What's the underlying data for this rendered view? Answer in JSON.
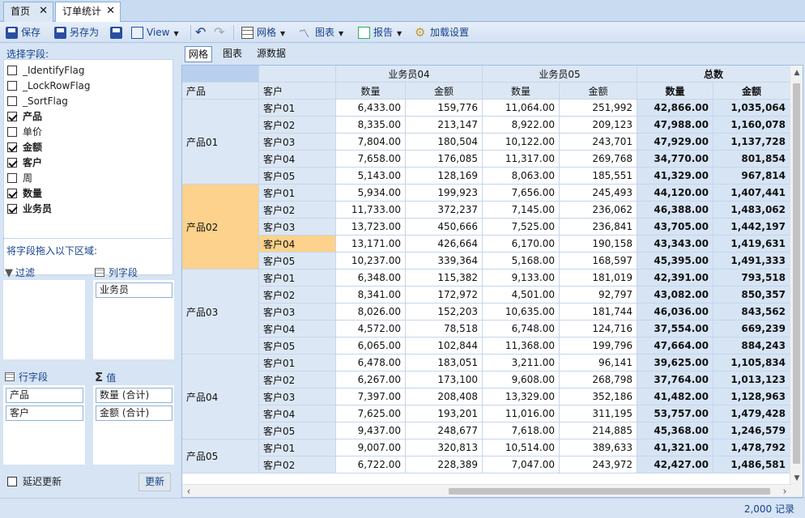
{
  "tabs": [
    {
      "label": "首页"
    },
    {
      "label": "订单统计"
    }
  ],
  "toolbar": {
    "save": "保存",
    "save_as": "另存为",
    "view": "View",
    "grid": "网格",
    "chart": "图表",
    "report": "报告",
    "load_settings": "加载设置"
  },
  "left": {
    "select_fields": "选择字段:",
    "fields": [
      {
        "label": "_IdentifyFlag",
        "checked": false
      },
      {
        "label": "_LockRowFlag",
        "checked": false
      },
      {
        "label": "_SortFlag",
        "checked": false
      },
      {
        "label": "产品",
        "checked": true
      },
      {
        "label": "单价",
        "checked": false
      },
      {
        "label": "金额",
        "checked": true
      },
      {
        "label": "客户",
        "checked": true
      },
      {
        "label": "周",
        "checked": false
      },
      {
        "label": "数量",
        "checked": true
      },
      {
        "label": "业务员",
        "checked": true
      }
    ],
    "drag_hint": "将字段拖入以下区域:",
    "filter_label": "过滤",
    "column_label": "列字段",
    "column_fields": [
      "业务员"
    ],
    "row_label": "行字段",
    "row_fields": [
      "产品",
      "客户"
    ],
    "value_label": "值",
    "value_fields": [
      "数量 (合计)",
      "金额 (合计)"
    ],
    "defer_update": "延迟更新",
    "refresh": "更新"
  },
  "view_tabs": [
    "网格",
    "图表",
    "源数据"
  ],
  "grid": {
    "header_groups": [
      "业务员04",
      "业务员05",
      "总数"
    ],
    "row_header_product": "产品",
    "row_header_customer": "客户",
    "qty": "数量",
    "amount": "金额",
    "rows": [
      {
        "product": "产品01",
        "customer": "客户01",
        "q4": "6,433.00",
        "a4": "159,776",
        "q5": "11,064.00",
        "a5": "251,992",
        "tq": "42,866.00",
        "ta": "1,035,064"
      },
      {
        "product": "",
        "customer": "客户02",
        "q4": "8,335.00",
        "a4": "213,147",
        "q5": "8,922.00",
        "a5": "209,123",
        "tq": "47,988.00",
        "ta": "1,160,078"
      },
      {
        "product": "",
        "customer": "客户03",
        "q4": "7,804.00",
        "a4": "180,504",
        "q5": "10,122.00",
        "a5": "243,701",
        "tq": "47,929.00",
        "ta": "1,137,728"
      },
      {
        "product": "",
        "customer": "客户04",
        "q4": "7,658.00",
        "a4": "176,085",
        "q5": "11,317.00",
        "a5": "269,768",
        "tq": "34,770.00",
        "ta": "801,854"
      },
      {
        "product": "",
        "customer": "客户05",
        "q4": "5,143.00",
        "a4": "128,169",
        "q5": "8,063.00",
        "a5": "185,551",
        "tq": "41,329.00",
        "ta": "967,814"
      },
      {
        "product": "产品02",
        "customer": "客户01",
        "q4": "5,934.00",
        "a4": "199,923",
        "q5": "7,656.00",
        "a5": "245,493",
        "tq": "44,120.00",
        "ta": "1,407,441"
      },
      {
        "product": "",
        "customer": "客户02",
        "q4": "11,733.00",
        "a4": "372,237",
        "q5": "7,145.00",
        "a5": "236,062",
        "tq": "46,388.00",
        "ta": "1,483,062"
      },
      {
        "product": "",
        "customer": "客户03",
        "q4": "13,723.00",
        "a4": "450,666",
        "q5": "7,525.00",
        "a5": "236,841",
        "tq": "43,705.00",
        "ta": "1,442,197"
      },
      {
        "product": "",
        "customer": "客户04",
        "q4": "13,171.00",
        "a4": "426,664",
        "q5": "6,170.00",
        "a5": "190,158",
        "tq": "43,343.00",
        "ta": "1,419,631"
      },
      {
        "product": "",
        "customer": "客户05",
        "q4": "10,237.00",
        "a4": "339,364",
        "q5": "5,168.00",
        "a5": "168,597",
        "tq": "45,395.00",
        "ta": "1,491,333"
      },
      {
        "product": "产品03",
        "customer": "客户01",
        "q4": "6,348.00",
        "a4": "115,382",
        "q5": "9,133.00",
        "a5": "181,019",
        "tq": "42,391.00",
        "ta": "793,518"
      },
      {
        "product": "",
        "customer": "客户02",
        "q4": "8,341.00",
        "a4": "172,972",
        "q5": "4,501.00",
        "a5": "92,797",
        "tq": "43,082.00",
        "ta": "850,357"
      },
      {
        "product": "",
        "customer": "客户03",
        "q4": "8,026.00",
        "a4": "152,203",
        "q5": "10,635.00",
        "a5": "181,744",
        "tq": "46,036.00",
        "ta": "843,562"
      },
      {
        "product": "",
        "customer": "客户04",
        "q4": "4,572.00",
        "a4": "78,518",
        "q5": "6,748.00",
        "a5": "124,716",
        "tq": "37,554.00",
        "ta": "669,239"
      },
      {
        "product": "",
        "customer": "客户05",
        "q4": "6,065.00",
        "a4": "102,844",
        "q5": "11,368.00",
        "a5": "199,796",
        "tq": "47,664.00",
        "ta": "884,243"
      },
      {
        "product": "产品04",
        "customer": "客户01",
        "q4": "6,478.00",
        "a4": "183,051",
        "q5": "3,211.00",
        "a5": "96,141",
        "tq": "39,625.00",
        "ta": "1,105,834"
      },
      {
        "product": "",
        "customer": "客户02",
        "q4": "6,267.00",
        "a4": "173,100",
        "q5": "9,608.00",
        "a5": "268,798",
        "tq": "37,764.00",
        "ta": "1,013,123"
      },
      {
        "product": "",
        "customer": "客户03",
        "q4": "7,397.00",
        "a4": "208,408",
        "q5": "13,329.00",
        "a5": "352,186",
        "tq": "41,482.00",
        "ta": "1,128,963"
      },
      {
        "product": "",
        "customer": "客户04",
        "q4": "7,625.00",
        "a4": "193,201",
        "q5": "11,016.00",
        "a5": "311,195",
        "tq": "53,757.00",
        "ta": "1,479,428"
      },
      {
        "product": "",
        "customer": "客户05",
        "q4": "9,437.00",
        "a4": "248,677",
        "q5": "7,618.00",
        "a5": "214,885",
        "tq": "45,368.00",
        "ta": "1,246,579"
      },
      {
        "product": "产品05",
        "customer": "客户01",
        "q4": "9,007.00",
        "a4": "320,813",
        "q5": "10,514.00",
        "a5": "389,633",
        "tq": "41,321.00",
        "ta": "1,478,792"
      },
      {
        "product": "",
        "customer": "客户02",
        "q4": "6,722.00",
        "a4": "228,389",
        "q5": "7,047.00",
        "a5": "243,972",
        "tq": "42,427.00",
        "ta": "1,486,581"
      }
    ]
  },
  "status": {
    "records": "2,000 记录"
  }
}
